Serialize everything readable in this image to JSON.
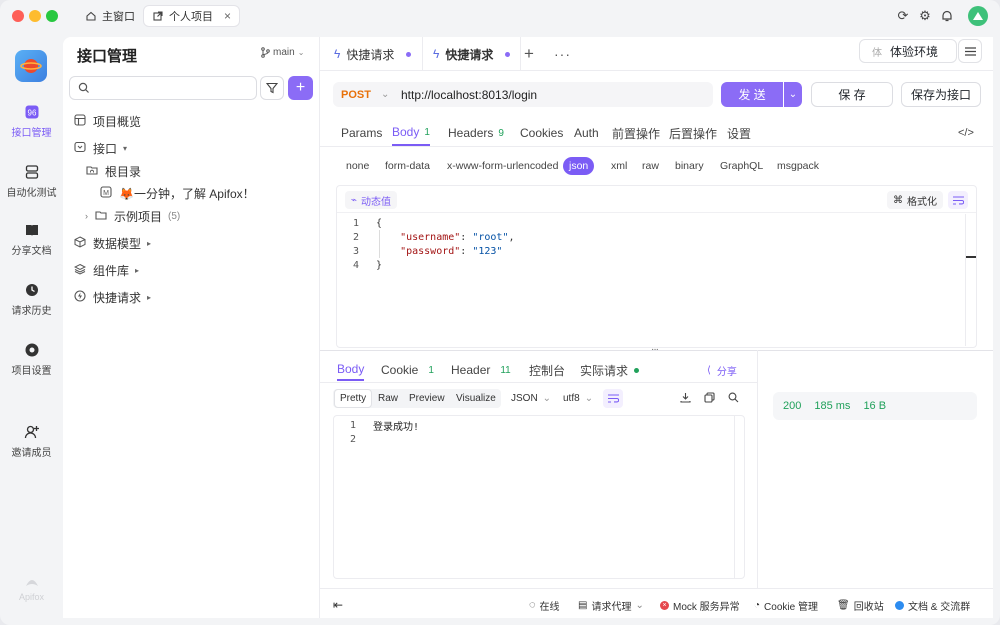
{
  "window_tabs": [
    {
      "label": "主窗口",
      "icon": "home-icon"
    },
    {
      "label": "个人项目",
      "icon": "external-link-icon"
    }
  ],
  "app_logo_text": "Apifox",
  "nav": [
    {
      "label": "接口管理",
      "icon": "api-icon",
      "active": true
    },
    {
      "label": "自动化测试",
      "icon": "automation-icon",
      "active": false
    },
    {
      "label": "分享文档",
      "icon": "book-icon",
      "active": false
    },
    {
      "label": "请求历史",
      "icon": "clock-icon",
      "active": false
    },
    {
      "label": "项目设置",
      "icon": "settings-icon",
      "active": false
    },
    {
      "label": "邀请成员",
      "icon": "add-user-icon",
      "active": false
    }
  ],
  "panel": {
    "title": "接口管理",
    "branch": "main",
    "search_placeholder": "",
    "tree": {
      "overview": "项目概览",
      "api": "接口",
      "root": "根目录",
      "doc": "🦊一分钟，了解 Apifox！",
      "examples": "示例项目",
      "examples_count": "(5)",
      "models": "数据模型",
      "components": "组件库",
      "quick": "快捷请求"
    }
  },
  "tabs": [
    {
      "label": "快捷请求"
    },
    {
      "label": "快捷请求"
    }
  ],
  "env": {
    "prefix": "体",
    "label": "体验环境"
  },
  "request": {
    "method": "POST",
    "url": "http://localhost:8013/login",
    "send": "发 送",
    "save": "保 存",
    "save_as": "保存为接口"
  },
  "req_tabs": {
    "params": "Params",
    "body": "Body",
    "body_count": "1",
    "headers": "Headers",
    "headers_count": "9",
    "cookies": "Cookies",
    "auth": "Auth",
    "pre": "前置操作",
    "post": "后置操作",
    "settings": "设置"
  },
  "body_types": [
    "none",
    "form-data",
    "x-www-form-urlencoded",
    "json",
    "xml",
    "raw",
    "binary",
    "GraphQL",
    "msgpack"
  ],
  "editor": {
    "dynamic": "动态值",
    "format": "格式化",
    "lines": [
      {
        "n": "1",
        "parts": [
          {
            "t": "{",
            "c": "p"
          }
        ]
      },
      {
        "n": "2",
        "parts": [
          {
            "t": "    \"username\"",
            "c": "k"
          },
          {
            "t": ": ",
            "c": "p"
          },
          {
            "t": "\"root\"",
            "c": "s"
          },
          {
            "t": ",",
            "c": "p"
          }
        ]
      },
      {
        "n": "3",
        "parts": [
          {
            "t": "    \"password\"",
            "c": "k"
          },
          {
            "t": ": ",
            "c": "p"
          },
          {
            "t": "\"123\"",
            "c": "s"
          }
        ]
      },
      {
        "n": "4",
        "parts": [
          {
            "t": "}",
            "c": "p"
          }
        ]
      }
    ]
  },
  "resp_tabs": {
    "body": "Body",
    "cookie": "Cookie",
    "cookie_count": "1",
    "header": "Header",
    "header_count": "11",
    "console": "控制台",
    "actual": "实际请求",
    "share": "分享"
  },
  "resp_views": {
    "pretty": "Pretty",
    "raw": "Raw",
    "preview": "Preview",
    "visualize": "Visualize",
    "format": "JSON",
    "encoding": "utf8"
  },
  "resp_lines": [
    {
      "n": "1",
      "text": "登录成功!"
    },
    {
      "n": "2",
      "text": ""
    }
  ],
  "resp_meta": {
    "status": "200",
    "time": "185 ms",
    "size": "16 B"
  },
  "statusbar": {
    "online": "在线",
    "proxy": "请求代理",
    "mock": "Mock 服务异常",
    "cookie": "Cookie 管理",
    "trash": "回收站",
    "docs": "文档 & 交流群"
  },
  "colors": {
    "accent": "#7b5cf5",
    "post": "#e8710a",
    "ok": "#21a15b"
  }
}
